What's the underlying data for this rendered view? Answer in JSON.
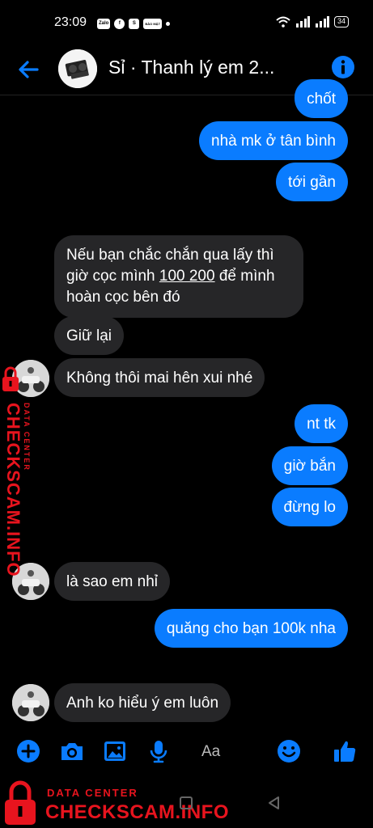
{
  "status": {
    "time": "23:09",
    "apps": [
      "Zalo",
      "f",
      "S",
      "BẢO MẬT"
    ],
    "battery": "34"
  },
  "header": {
    "title": "Sỉ · Thanh lý em 2..."
  },
  "messages": [
    {
      "dir": "out",
      "text": "chốt"
    },
    {
      "dir": "out",
      "text": "nhà mk ở tân bình"
    },
    {
      "dir": "out",
      "text": "tới gần"
    },
    {
      "dir": "in",
      "text_1": "Nếu bạn chắc chắn qua lấy thì",
      "text_2_pre": "giờ cọc mình ",
      "text_2_link": "100 200",
      "text_2_post": " để mình",
      "text_3": "hoàn cọc bên đó"
    },
    {
      "dir": "in",
      "text": "Giữ lại"
    },
    {
      "dir": "in",
      "text": "Không thôi mai hên xui nhé"
    },
    {
      "dir": "out",
      "text": "nt tk"
    },
    {
      "dir": "out",
      "text": "giờ bắn"
    },
    {
      "dir": "out",
      "text": "đừng lo"
    },
    {
      "dir": "in",
      "text": "là sao em nhỉ"
    },
    {
      "dir": "out",
      "text": "quăng cho bạn 100k nha"
    },
    {
      "dir": "in",
      "text": "Anh ko hiểu ý em luôn"
    }
  ],
  "composer": {
    "placeholder": "Aa"
  },
  "watermark": {
    "small": "DATA CENTER",
    "big": "CHECKSCAM.INFO"
  },
  "colors": {
    "accent": "#0a7cff",
    "incoming": "#262628",
    "watermark": "#e8141e"
  }
}
